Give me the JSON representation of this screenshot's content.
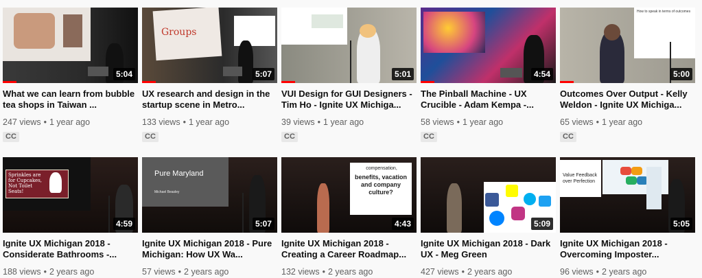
{
  "colors": {
    "progress": "#ff0000",
    "background": "#f9f9f9"
  },
  "videos": [
    {
      "title": "What we can learn from bubble tea shops in Taiwan ...",
      "views": "247 views",
      "age": "1 year ago",
      "duration": "5:04",
      "cc": "CC",
      "progress": 0.1
    },
    {
      "title": "UX research and design in the startup scene in Metro...",
      "views": "133 views",
      "age": "1 year ago",
      "duration": "5:07",
      "cc": "CC",
      "progress": 0.1,
      "slide_text": "Groups"
    },
    {
      "title": "VUI Design for GUI Designers - Tim Ho - Ignite UX Michiga...",
      "views": "39 views",
      "age": "1 year ago",
      "duration": "5:01",
      "cc": "CC",
      "progress": 0.1
    },
    {
      "title": "The Pinball Machine - UX Crucible - Adam Kempa -...",
      "views": "58 views",
      "age": "1 year ago",
      "duration": "4:54",
      "cc": "CC",
      "progress": 0.1
    },
    {
      "title": "Outcomes Over Output - Kelly Weldon - Ignite UX Michiga...",
      "views": "65 views",
      "age": "1 year ago",
      "duration": "5:00",
      "cc": "CC",
      "progress": 0.1,
      "slide_text": "How to speak in terms of outcomes"
    },
    {
      "title": "Ignite UX Michigan 2018 - Considerate Bathrooms -...",
      "views": "188 views",
      "age": "2 years ago",
      "duration": "4:59",
      "slide_text": "Sprinkles are for Cupcakes, Not Toilet Seats!"
    },
    {
      "title": "Ignite UX Michigan 2018 - Pure Michigan: How UX Wa...",
      "views": "57 views",
      "age": "2 years ago",
      "duration": "5:07",
      "slide_text": "Pure Maryland",
      "slide_sub": "Michael Beasley"
    },
    {
      "title": "Ignite UX Michigan 2018 - Creating a Career Roadmap...",
      "views": "132 views",
      "age": "2 years ago",
      "duration": "4:43",
      "slide_text": "benefits, vacation and company culture?",
      "slide_small": "compensation,"
    },
    {
      "title": "Ignite UX Michigan 2018 - Dark UX - Meg Green",
      "views": "427 views",
      "age": "2 years ago",
      "duration": "5:09"
    },
    {
      "title": "Ignite UX Michigan 2018 - Overcoming Imposter...",
      "views": "96 views",
      "age": "2 years ago",
      "duration": "5:05",
      "slide_text": "Value Feedback over Perfection"
    }
  ]
}
